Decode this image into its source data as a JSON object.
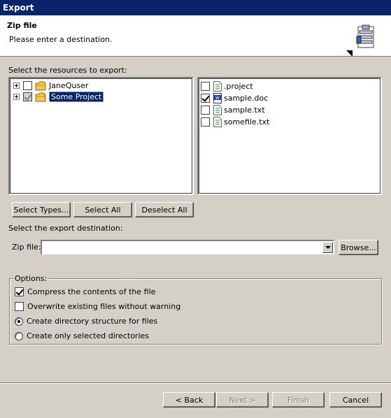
{
  "window": {
    "title": "Export"
  },
  "banner": {
    "title": "Zip file",
    "message": "Please enter a destination.",
    "icon": "zip-file-wizard-icon"
  },
  "resources": {
    "label": "Select the resources to export:",
    "tree": [
      {
        "label": "JaneQuser",
        "checked": false,
        "grayed": false,
        "selected": false,
        "icon": "folder-icon"
      },
      {
        "label": "Some Project",
        "checked": true,
        "grayed": true,
        "selected": true,
        "icon": "folder-icon"
      }
    ],
    "files": [
      {
        "label": ".project",
        "checked": false,
        "icon": "text-file-icon"
      },
      {
        "label": "sample.doc",
        "checked": true,
        "icon": "word-document-icon"
      },
      {
        "label": "sample.txt",
        "checked": false,
        "icon": "text-file-icon"
      },
      {
        "label": "somefile.txt",
        "checked": false,
        "icon": "text-file-icon"
      }
    ]
  },
  "buttons": {
    "select_types": "Select Types...",
    "select_all": "Select All",
    "deselect_all": "Deselect All"
  },
  "destination": {
    "label": "Select the export destination:",
    "zip_label": "Zip file:",
    "zip_value": "",
    "browse": "Browse..."
  },
  "options": {
    "title": "Options:",
    "compress": {
      "label": "Compress the contents of the file",
      "checked": true
    },
    "overwrite": {
      "label": "Overwrite existing files without warning",
      "checked": false
    },
    "create_structure": {
      "label": "Create directory structure for files",
      "selected": true
    },
    "create_selected": {
      "label": "Create only selected directories",
      "selected": false
    }
  },
  "footer": {
    "back": "< Back",
    "next": "Next >",
    "finish": "Finish",
    "cancel": "Cancel"
  }
}
